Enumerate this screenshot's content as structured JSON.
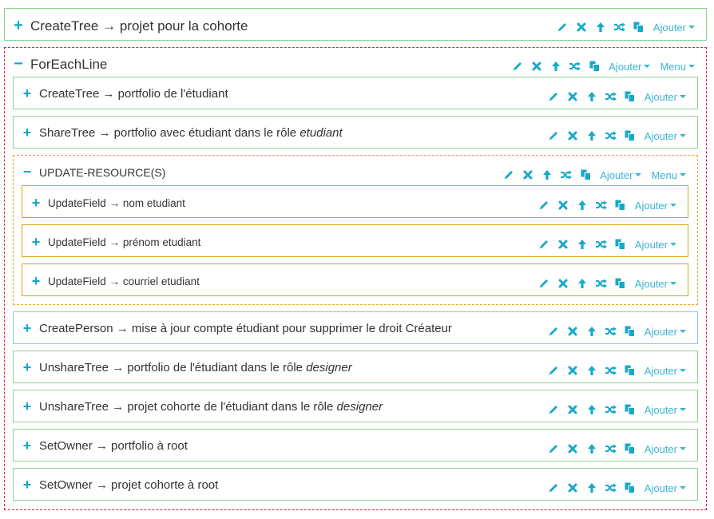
{
  "colors": {
    "accent": "#17a9c8",
    "green_border": "#8fd18f",
    "red_dashed": "#d9203a",
    "orange_dashed": "#f0a81e",
    "orange_border": "#d9a21a",
    "blue_border": "#8ccbe6"
  },
  "icons": [
    "pencil-icon",
    "times-icon",
    "arrow-up-icon",
    "random-icon",
    "copy-icon"
  ],
  "labels": {
    "ajouter": "Ajouter",
    "menu": "Menu"
  },
  "top": {
    "expander": "+",
    "name": "CreateTree",
    "arrow": "→",
    "desc": "projet pour la cohorte"
  },
  "foreach": {
    "expander": "−",
    "title": "ForEachLine"
  },
  "items": [
    {
      "expander": "+",
      "name": "CreateTree",
      "arrow": "→",
      "desc": "portfolio de l'étudiant",
      "italic": ""
    },
    {
      "expander": "+",
      "name": "ShareTree",
      "arrow": "→",
      "desc": "portfolio avec étudiant dans le rôle",
      "italic": "etudiant"
    }
  ],
  "update": {
    "expander": "−",
    "title": "UPDATE-RESOURCE(S)",
    "fields": [
      {
        "expander": "+",
        "name": "UpdateField",
        "arrow": "→",
        "desc": "nom etudiant"
      },
      {
        "expander": "+",
        "name": "UpdateField",
        "arrow": "→",
        "desc": "prénom etudiant"
      },
      {
        "expander": "+",
        "name": "UpdateField",
        "arrow": "→",
        "desc": "courriel etudiant"
      }
    ]
  },
  "items2": [
    {
      "expander": "+",
      "name": "CreatePerson",
      "arrow": "→",
      "desc": "mise à jour compte étudiant pour supprimer le droit Créateur",
      "italic": ""
    },
    {
      "expander": "+",
      "name": "UnshareTree",
      "arrow": "→",
      "desc": "portfolio de l'étudiant dans le rôle",
      "italic": "designer"
    },
    {
      "expander": "+",
      "name": "UnshareTree",
      "arrow": "→",
      "desc": "projet cohorte de l'étudiant dans le rôle",
      "italic": "designer"
    },
    {
      "expander": "+",
      "name": "SetOwner",
      "arrow": "→",
      "desc": "portfolio à root",
      "italic": ""
    },
    {
      "expander": "+",
      "name": "SetOwner",
      "arrow": "→",
      "desc": "projet cohorte à root",
      "italic": ""
    }
  ]
}
